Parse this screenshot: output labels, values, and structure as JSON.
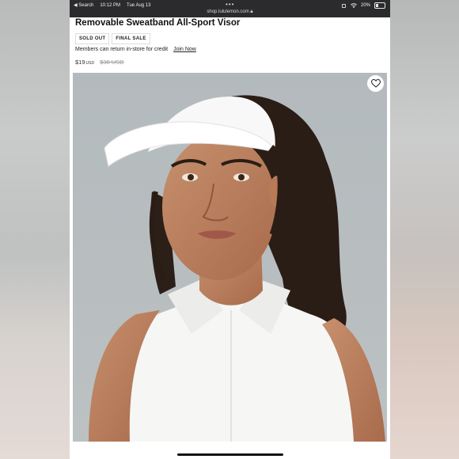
{
  "status_bar": {
    "back_label": "Search",
    "time": "10:12 PM",
    "date": "Tue Aug 13",
    "url": "shop.lululemon.com",
    "battery": "20%"
  },
  "product": {
    "title": "Removable Sweatband All-Sport Visor",
    "badges": [
      "SOLD OUT",
      "FINAL SALE"
    ],
    "members_text": "Members can return in-store for credit",
    "join_label": "Join Now",
    "price": "$19",
    "price_currency": "USD",
    "original_price": "$38 USD"
  },
  "icons": {
    "wishlist": "heart-icon",
    "wifi": "wifi-icon",
    "battery": "battery-icon",
    "lock": "lock-icon"
  },
  "colors": {
    "status_bar": "#2b2b2d",
    "photo_background": "#b6bcbe"
  }
}
